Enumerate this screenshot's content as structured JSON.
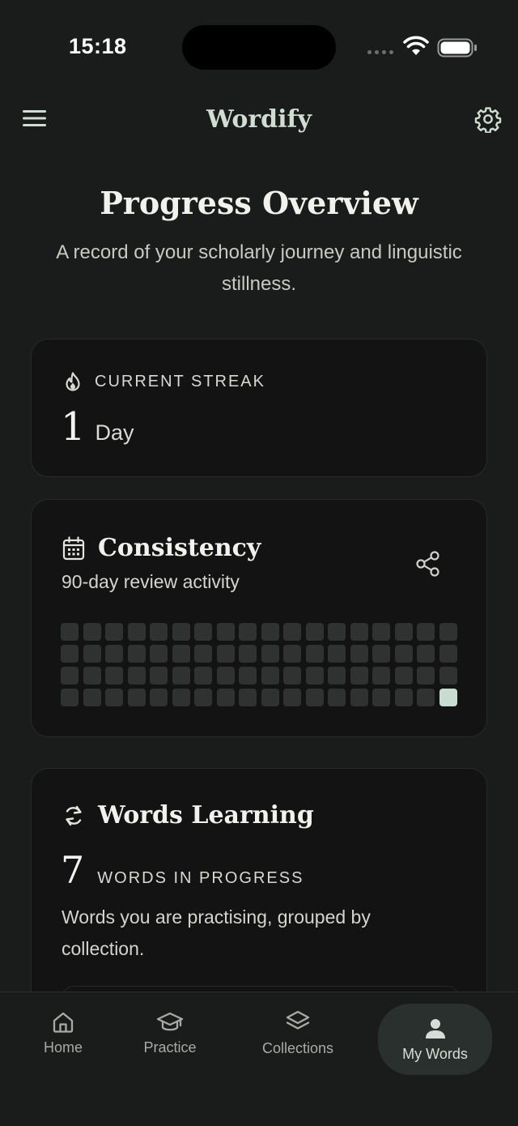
{
  "status_bar": {
    "time": "15:18"
  },
  "header": {
    "app_title": "Wordify"
  },
  "page": {
    "title": "Progress Overview",
    "subtitle": "A record of your scholarly journey and linguistic stillness."
  },
  "streak_card": {
    "icon": "flame-icon",
    "label": "CURRENT STREAK",
    "value": "1",
    "unit": "Day"
  },
  "consistency_card": {
    "icon": "calendar-icon",
    "title": "Consistency",
    "subtitle": "90-day review activity",
    "share_icon": "share-icon",
    "grid_columns": 18,
    "grid_rows": 4,
    "active_cell_indices": [
      71
    ],
    "active_color": "#c9dcd0",
    "inactive_color": "#2f3231"
  },
  "words_card": {
    "icon": "refresh-icon",
    "title": "Words Learning",
    "count": "7",
    "count_label": "WORDS IN PROGRESS",
    "description": "Words you are practising, grouped by collection."
  },
  "tabs": [
    {
      "label": "Home",
      "icon": "home-icon"
    },
    {
      "label": "Practice",
      "icon": "graduation-cap-icon"
    },
    {
      "label": "Collections",
      "icon": "layers-icon"
    },
    {
      "label": "My Words",
      "icon": "user-icon",
      "active": true
    }
  ]
}
